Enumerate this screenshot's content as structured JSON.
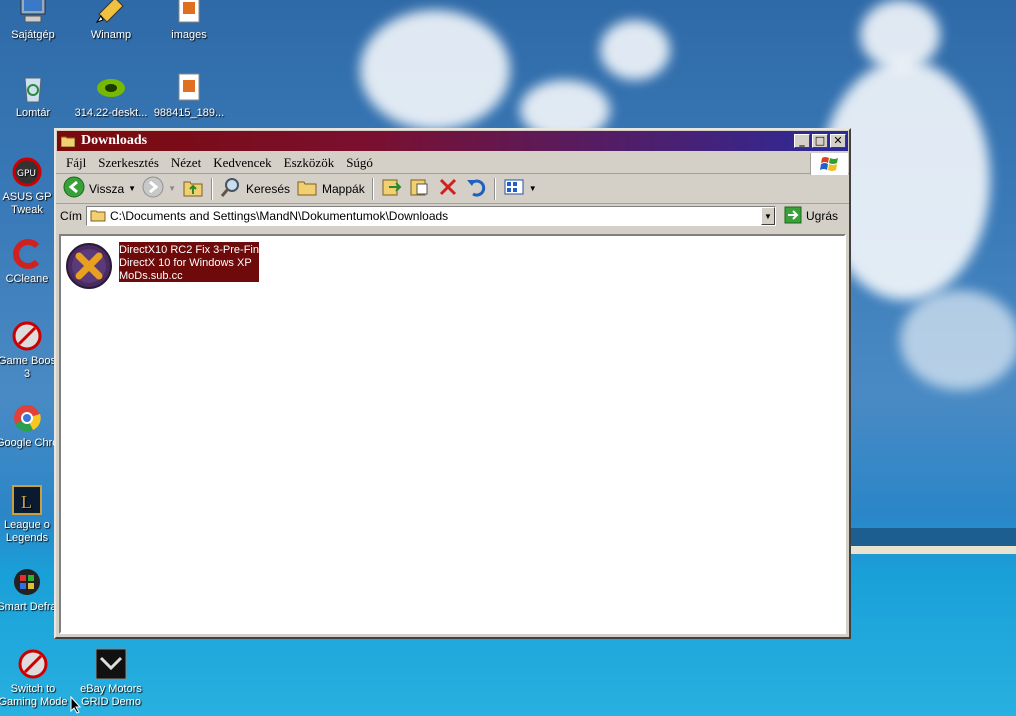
{
  "desktop": {
    "icons": [
      {
        "label": "Sajátgép"
      },
      {
        "label": "Winamp"
      },
      {
        "label": "images"
      },
      {
        "label": "Lomtár"
      },
      {
        "label": "314.22-deskt..."
      },
      {
        "label": "988415_189..."
      },
      {
        "label1": "ASUS GP",
        "label2": "Tweak"
      },
      {
        "label": "CCleane"
      },
      {
        "label1": "Game Boos",
        "label2": "3"
      },
      {
        "label": "Google Chro"
      },
      {
        "label1": "League o",
        "label2": "Legends"
      },
      {
        "label": "Smart Defra"
      },
      {
        "label1": "Switch to",
        "label2": "Gaming Mode"
      },
      {
        "label1": "eBay Motors",
        "label2": "GRID Demo"
      }
    ]
  },
  "window": {
    "title": "Downloads",
    "controls": {
      "minimize": "_",
      "maximize": "□",
      "close": "✕"
    },
    "menu": [
      "Fájl",
      "Szerkesztés",
      "Nézet",
      "Kedvencek",
      "Eszközök",
      "Súgó"
    ],
    "toolbar": {
      "back_label": "Vissza",
      "search_label": "Keresés",
      "folders_label": "Mappák"
    },
    "address": {
      "label": "Cím",
      "value": "C:\\Documents and Settings\\MandN\\Dokumentumok\\Downloads",
      "go_label": "Ugrás"
    },
    "files": [
      {
        "line1": "DirectX10 RC2 Fix 3-Pre-Final",
        "line2": "DirectX 10 for Windows XP",
        "line3": "MoDs.sub.cc",
        "selected": true
      }
    ]
  },
  "colors": {
    "title_start": "#7a0a0a",
    "title_end": "#2c2a9a",
    "selection": "#6e0a0a",
    "face": "#d4d0c8"
  }
}
